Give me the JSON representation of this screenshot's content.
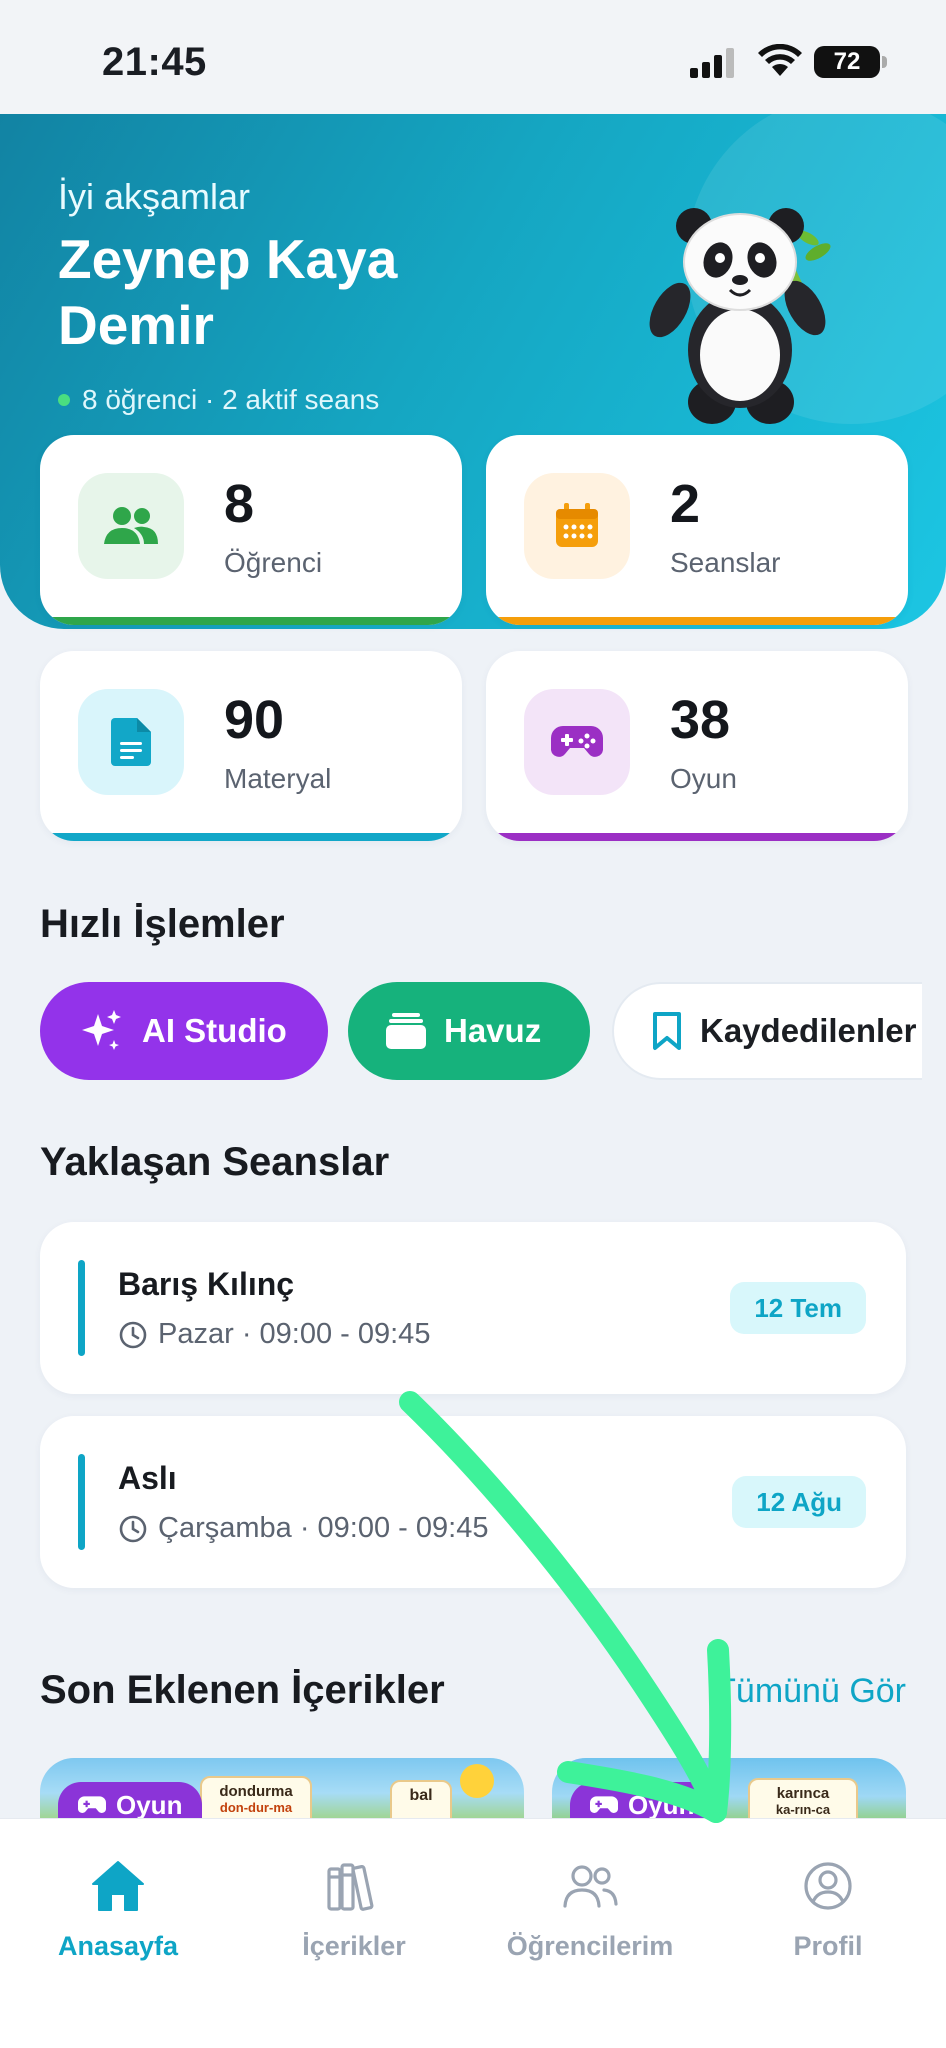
{
  "status_bar": {
    "time": "21:45",
    "battery": "72"
  },
  "hero": {
    "greeting": "İyi akşamlar",
    "name": "Zeynep Kaya Demir",
    "summary": "8 öğrenci · 2 aktif seans"
  },
  "stats": [
    {
      "value": "8",
      "label": "Öğrenci",
      "icon": "users-icon",
      "color": "#2fa64a"
    },
    {
      "value": "2",
      "label": "Seanslar",
      "icon": "calendar-icon",
      "color": "#f59e0b"
    },
    {
      "value": "90",
      "label": "Materyal",
      "icon": "document-icon",
      "color": "#12a7c8"
    },
    {
      "value": "38",
      "label": "Oyun",
      "icon": "gamepad-icon",
      "color": "#9b2fc4"
    }
  ],
  "quick_actions": {
    "title": "Hızlı İşlemler",
    "items": [
      {
        "label": "AI Studio",
        "icon": "sparkles-icon"
      },
      {
        "label": "Havuz",
        "icon": "stack-icon"
      },
      {
        "label": "Kaydedilenler",
        "icon": "bookmark-icon"
      }
    ]
  },
  "upcoming": {
    "title": "Yaklaşan Seanslar",
    "sessions": [
      {
        "student": "Barış Kılınç",
        "time": "Pazar · 09:00 - 09:45",
        "date": "12 Tem"
      },
      {
        "student": "Aslı",
        "time": "Çarşamba · 09:00 - 09:45",
        "date": "12 Ağu"
      }
    ]
  },
  "recent": {
    "title": "Son Eklenen İçerikler",
    "see_all": "Tümünü Gör",
    "items": [
      {
        "tag": "Oyun",
        "cards": [
          "dondurma",
          "don-dur-ma",
          "bal"
        ]
      },
      {
        "tag": "Oyun",
        "cards": [
          "karınca",
          "ka-rın-ca"
        ]
      }
    ]
  },
  "nav": {
    "items": [
      {
        "label": "Anasayfa",
        "icon": "home-icon",
        "active": true
      },
      {
        "label": "İçerikler",
        "icon": "library-icon",
        "active": false
      },
      {
        "label": "Öğrencilerim",
        "icon": "students-icon",
        "active": false
      },
      {
        "label": "Profil",
        "icon": "profile-icon",
        "active": false
      }
    ]
  },
  "colors": {
    "accent": "#0ea5c6",
    "purple": "#9333ea",
    "green": "#16b27c",
    "annotation": "#3ef29a"
  }
}
